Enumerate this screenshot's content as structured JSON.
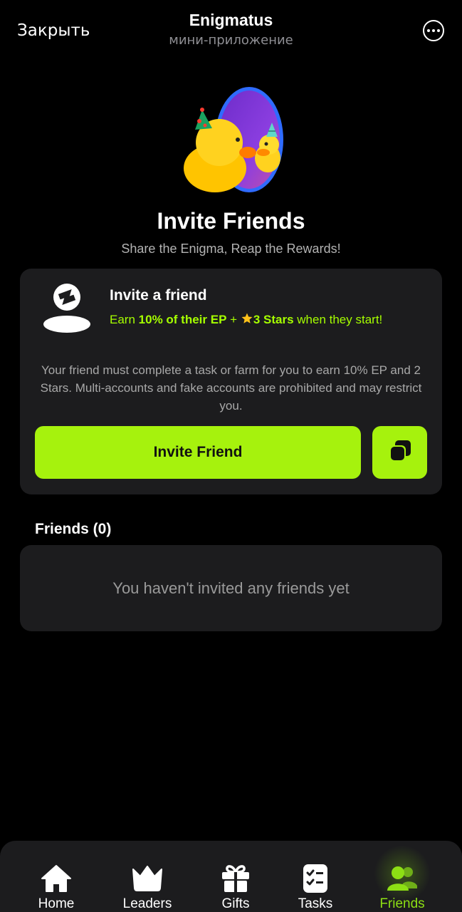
{
  "header": {
    "close_label": "Закрыть",
    "title": "Enigmatus",
    "subtitle": "мини-приложение",
    "menu_icon": "more-horizontal-icon"
  },
  "hero": {
    "image": "ducks-party-illustration",
    "title": "Invite Friends",
    "subtitle": "Share the Enigma, Reap the Rewards!"
  },
  "invite_card": {
    "icon": "user-with-logo-icon",
    "heading": "Invite a friend",
    "reward_prefix": "Earn",
    "reward_percent": "10% of their EP",
    "reward_plus": "+",
    "reward_stars": "3 Stars",
    "reward_suffix": "when they start!",
    "note": "Your friend must complete a task or farm for you to earn 10% EP and 2 Stars. Multi-accounts and fake accounts are prohibited and may restrict you.",
    "invite_button_label": "Invite Friend",
    "copy_button_icon": "copy-icon"
  },
  "friends": {
    "heading": "Friends (0)",
    "empty_text": "You haven't invited any friends yet"
  },
  "nav": {
    "items": [
      {
        "label": "Home",
        "icon": "home-icon",
        "active": false
      },
      {
        "label": "Leaders",
        "icon": "crown-icon",
        "active": false
      },
      {
        "label": "Gifts",
        "icon": "gift-icon",
        "active": false
      },
      {
        "label": "Tasks",
        "icon": "checklist-icon",
        "active": false
      },
      {
        "label": "Friends",
        "icon": "users-icon",
        "active": true
      }
    ]
  },
  "colors": {
    "background": "#000000",
    "card": "#1c1c1e",
    "accent": "#a6f20d",
    "active_nav": "#8ddf14"
  }
}
